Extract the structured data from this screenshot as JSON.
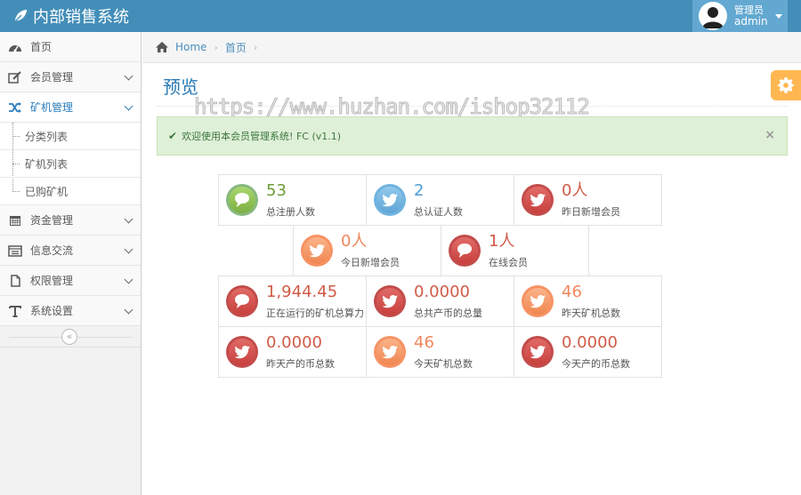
{
  "navbar": {
    "brand": "内部销售系统",
    "user_role": "管理员",
    "user_name": "admin"
  },
  "sidebar": {
    "items": [
      {
        "label": "首页",
        "icon": "dashboard-icon"
      },
      {
        "label": "会员管理",
        "icon": "edit-icon"
      },
      {
        "label": "矿机管理",
        "icon": "shuffle-icon"
      },
      {
        "label": "资金管理",
        "icon": "calendar-icon"
      },
      {
        "label": "信息交流",
        "icon": "list-icon"
      },
      {
        "label": "权限管理",
        "icon": "file-icon"
      },
      {
        "label": "系统设置",
        "icon": "text-icon"
      }
    ],
    "subitems": [
      "分类列表",
      "矿机列表",
      "已购矿机"
    ],
    "collapse_glyph": "«"
  },
  "breadcrumb": {
    "home": "Home",
    "current": "首页",
    "sep": "›"
  },
  "page": {
    "title": "预览",
    "watermark": "https://www.huzhan.com/ishop32112"
  },
  "alert": {
    "text": "欢迎使用本会员管理系统! FC (v1.1)",
    "close": "×"
  },
  "stats": [
    {
      "value": "53",
      "label": "总注册人数",
      "color": "green",
      "icon": "comments-icon"
    },
    {
      "value": "2",
      "label": "总认证人数",
      "color": "blue",
      "icon": "twitter-icon"
    },
    {
      "value": "0人",
      "label": "昨日新增会员",
      "color": "red",
      "icon": "twitter-icon"
    },
    {
      "value": "0人",
      "label": "今日新增会员",
      "color": "orange",
      "icon": "twitter-icon"
    },
    {
      "value": "1人",
      "label": "在线会员",
      "color": "red",
      "icon": "comments-icon"
    },
    {
      "value": "1,944.45",
      "label": "正在运行的矿机总算力",
      "color": "red",
      "icon": "comments-icon"
    },
    {
      "value": "0.0000",
      "label": "总共产币的总量",
      "color": "red",
      "icon": "twitter-icon"
    },
    {
      "value": "46",
      "label": "昨天矿机总数",
      "color": "orange",
      "icon": "twitter-icon"
    },
    {
      "value": "0.0000",
      "label": "昨天产的币总数",
      "color": "red",
      "icon": "twitter-icon"
    },
    {
      "value": "46",
      "label": "今天矿机总数",
      "color": "orange",
      "icon": "twitter-icon"
    },
    {
      "value": "0.0000",
      "label": "今天产的币总数",
      "color": "red",
      "icon": "twitter-icon"
    }
  ],
  "colors": {
    "navbar": "#438eb9",
    "accent": "#2679b5",
    "green": "#87b87f",
    "blue": "#6fb3e0",
    "red": "#c24c4a",
    "orange": "#f79263"
  }
}
